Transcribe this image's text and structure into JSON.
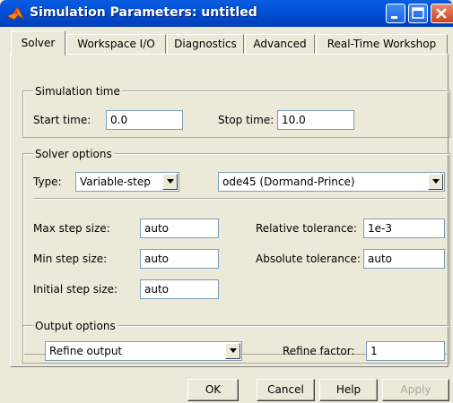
{
  "window": {
    "title": "Simulation Parameters: untitled"
  },
  "tabs": [
    "Solver",
    "Workspace I/O",
    "Diagnostics",
    "Advanced",
    "Real-Time Workshop"
  ],
  "simulation_time": {
    "group_label": "Simulation time",
    "start_label": "Start time:",
    "start_value": "0.0",
    "stop_label": "Stop time:",
    "stop_value": "10.0"
  },
  "solver_options": {
    "group_label": "Solver options",
    "type_label": "Type:",
    "type_value": "Variable-step",
    "solver_value": "ode45 (Dormand-Prince)",
    "max_step_label": "Max step size:",
    "max_step_value": "auto",
    "min_step_label": "Min step size:",
    "min_step_value": "auto",
    "initial_step_label": "Initial step size:",
    "initial_step_value": "auto",
    "rel_tol_label": "Relative tolerance:",
    "rel_tol_value": "1e-3",
    "abs_tol_label": "Absolute tolerance:",
    "abs_tol_value": "auto"
  },
  "output_options": {
    "group_label": "Output options",
    "output_value": "Refine output",
    "refine_label": "Refine factor:",
    "refine_value": "1"
  },
  "buttons": {
    "ok": "OK",
    "cancel": "Cancel",
    "help": "Help",
    "apply": "Apply"
  }
}
